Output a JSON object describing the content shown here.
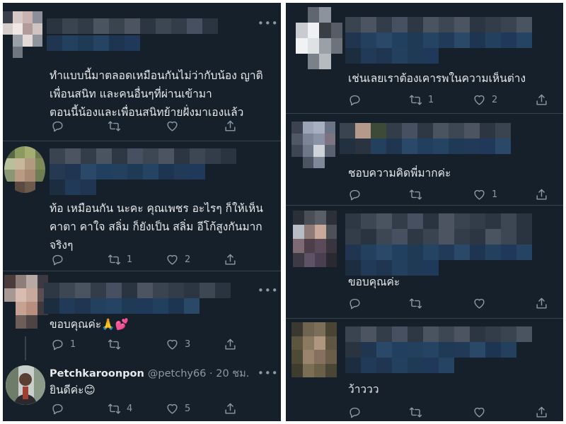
{
  "left": {
    "tweets": [
      {
        "text": "ทำแบบนี้มาตลอดเหมือนกันไม่ว่ากับน้อง ญาติ\nเพื่อนสนิท และคนอื่นๆที่ผ่านเข้ามา\nตอนนี้น้องและเพื่อนสนิทย้ายฝั่งมาเองแล้ว",
        "reply": "",
        "retweet": "",
        "like": "",
        "share": ""
      },
      {
        "text": "ท้อ เหมือนกัน นะคะ คุณเพชร อะไรๆ ก็ให้เห็น\nคาตา คาใจ สลิ่ม ก็ยังเป็น สลิ่ม อีโก้สูงกันมาก\nจริงๆ",
        "reply": "",
        "retweet": "1",
        "like": "2",
        "share": ""
      },
      {
        "text": "ขอบคุณค่ะ🙏💕",
        "reply": "1",
        "retweet": "",
        "like": "3",
        "share": ""
      },
      {
        "name": "Petchkaroonpon",
        "handle": "@petchy66 · 20 ชม.",
        "text": "ยินดีค่ะ😊",
        "reply": "",
        "retweet": "4",
        "like": "5",
        "share": ""
      }
    ]
  },
  "right": {
    "tweets": [
      {
        "text": "เช่นเลยเราต้องเคารพในความเห็นต่าง",
        "reply": "",
        "retweet": "1",
        "like": "2",
        "share": ""
      },
      {
        "text": "ชอบความคิดพี่มากค่ะ",
        "reply": "",
        "retweet": "",
        "like": "1",
        "share": ""
      },
      {
        "text": "ขอบคุณค่ะ",
        "reply": "",
        "retweet": "",
        "like": "",
        "share": ""
      },
      {
        "text": "ว้าววว",
        "reply": "",
        "retweet": "",
        "like": "",
        "share": ""
      }
    ]
  },
  "more_glyph": "•••",
  "icons": {
    "reply": "reply-icon",
    "retweet": "retweet-icon",
    "like": "heart-icon",
    "share": "share-icon",
    "more": "more-icon"
  },
  "colors": {
    "background": "#15202b",
    "divider": "#38444d",
    "text": "#e7e9ea",
    "secondary": "#8b98a5"
  }
}
